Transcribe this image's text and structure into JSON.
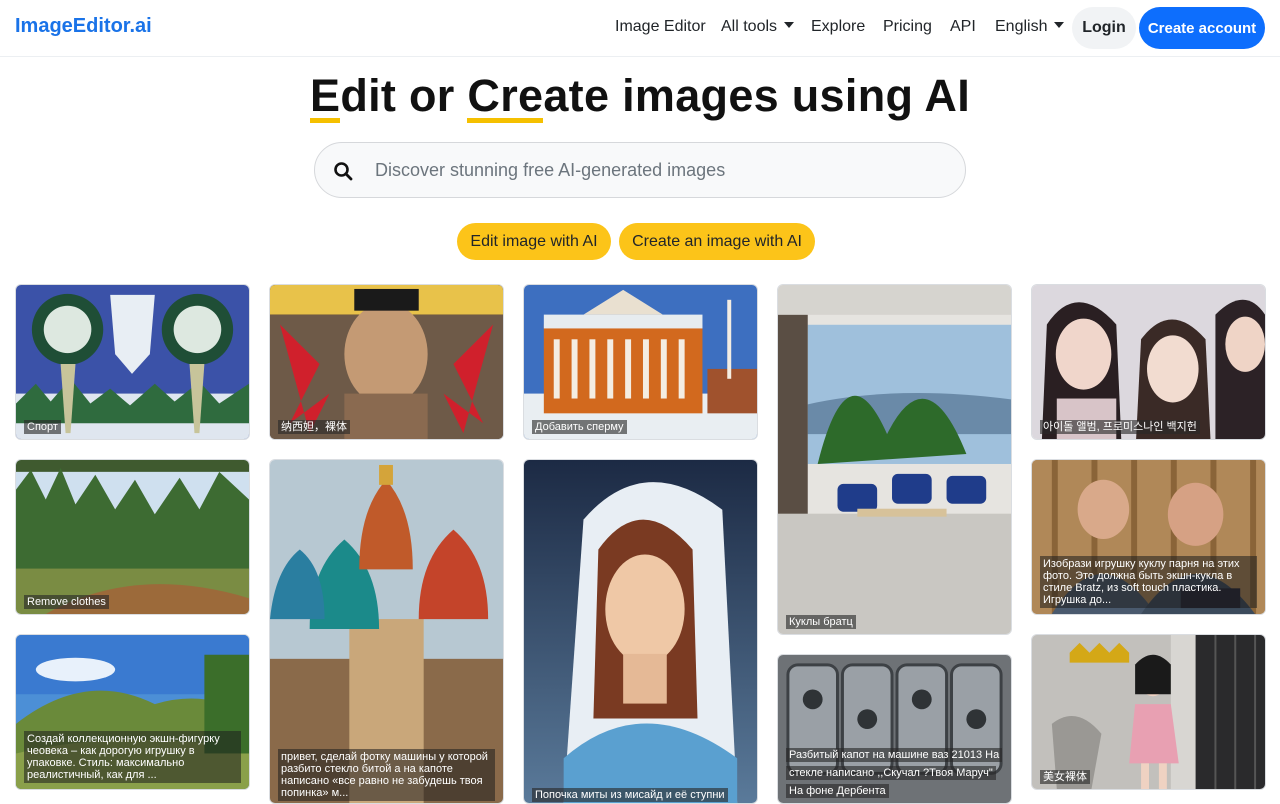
{
  "brand": "ImageEditor.ai",
  "nav": {
    "image_editor": "Image Editor",
    "all_tools": "All tools",
    "explore": "Explore",
    "pricing": "Pricing",
    "api": "API",
    "language": "English",
    "login": "Login",
    "create_account": "Create account"
  },
  "hero": {
    "title_part1_u": "E",
    "title_part1": "dit or ",
    "title_part2_u": "Cre",
    "title_part2": "ate images using AI"
  },
  "search": {
    "placeholder": "Discover stunning free AI-generated images"
  },
  "actions": {
    "edit": "Edit image with AI",
    "create": "Create an image with AI"
  },
  "gallery": [
    {
      "caption": "Спорт"
    },
    {
      "caption": "纳西妲，裸体"
    },
    {
      "caption": "Добавить сперму"
    },
    {
      "caption": "Куклы братц"
    },
    {
      "caption": "아이돌 앨범, 프로미스나인 백지헌"
    },
    {
      "caption": "Remove clothes"
    },
    {
      "caption": "привет, сделай фотку машины у которой разбито стекло битой а на капоте написано «все равно не забудешь твоя попинка» м..."
    },
    {
      "caption": "Попочка миты из мисайд и её ступни"
    },
    {
      "caption": "Изобрази игрушку куклу парня на этих фото. Это должна быть экшн-кукла в стиле Bratz, из soft touch пластика. Игрушка до..."
    },
    {
      "caption": "Создай коллекционную экшн-фигурку чeoвека – как дорогую игрушку в упаковке. Стиль: максимально реалистичный, как для ..."
    },
    {
      "caption": "Разбитый капот на машине ваз 21013 На стекле написано ,,Скучал ?Твоя Маруч\" На фоне Дербента"
    },
    {
      "caption": "美女裸体"
    }
  ],
  "colors": {
    "brand": "#1a73e8",
    "primary_button": "#0d6efd",
    "accent_yellow": "#fcc419"
  }
}
